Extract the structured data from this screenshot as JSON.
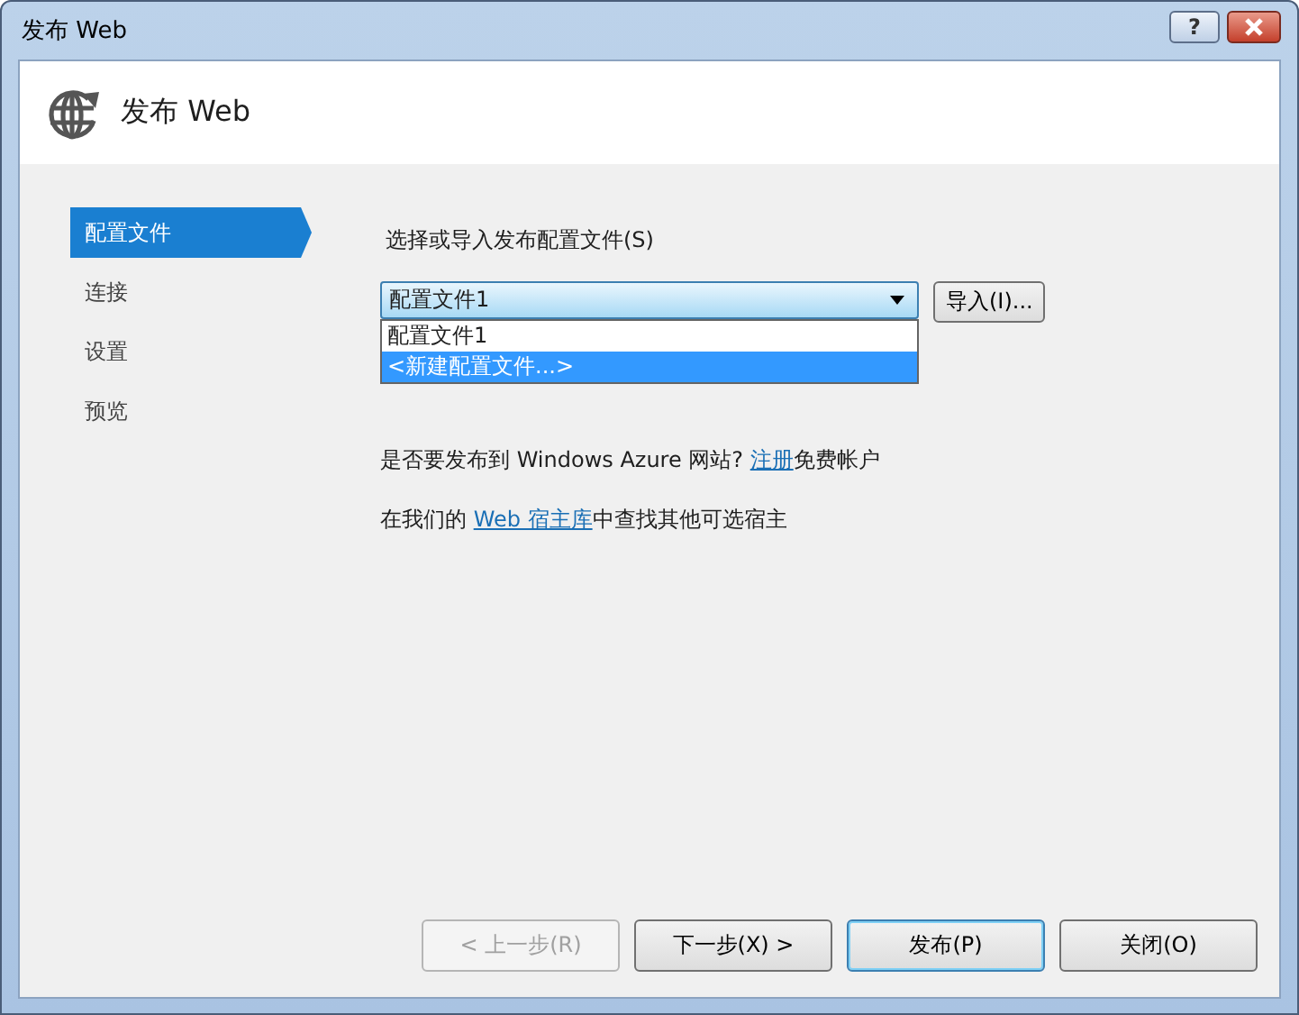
{
  "window": {
    "title": "发布 Web",
    "help_button": "?"
  },
  "header": {
    "title": "发布 Web"
  },
  "nav": [
    {
      "label": "配置文件",
      "selected": true
    },
    {
      "label": "连接",
      "selected": false
    },
    {
      "label": "设置",
      "selected": false
    },
    {
      "label": "预览",
      "selected": false
    }
  ],
  "profile": {
    "label": "选择或导入发布配置文件(S)",
    "combo_value": "配置文件1",
    "expanded": true,
    "options": [
      {
        "label": "配置文件1",
        "selected": false
      },
      {
        "label": "<新建配置文件...>",
        "selected": true
      }
    ],
    "import_button": "导入(I)..."
  },
  "azure_line": {
    "before": "是否要发布到 Windows Azure 网站? ",
    "link": "注册",
    "after": "免费帐户"
  },
  "hosts_line": {
    "before": "在我们的 ",
    "link": "Web 宿主库",
    "after": "中查找其他可选宿主"
  },
  "buttons": [
    {
      "label": "< 上一步(R)",
      "disabled": true,
      "default": false
    },
    {
      "label": "下一步(X) >",
      "disabled": false,
      "default": false
    },
    {
      "label": "发布(P)",
      "disabled": false,
      "default": true
    },
    {
      "label": "关闭(O)",
      "disabled": false,
      "default": false
    }
  ]
}
